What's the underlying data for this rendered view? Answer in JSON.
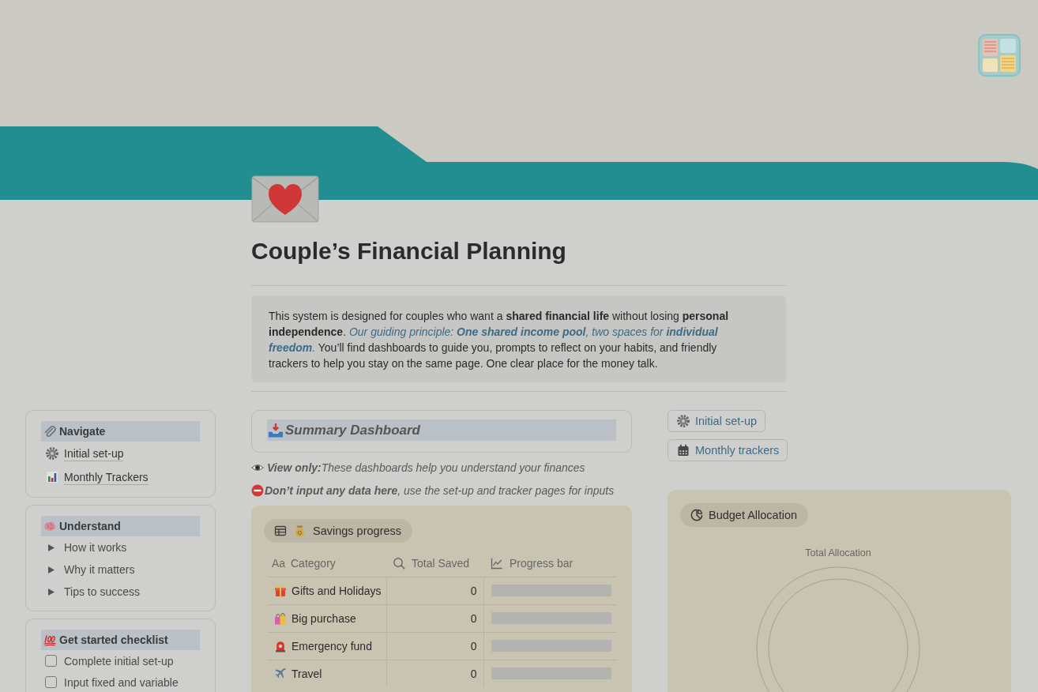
{
  "page": {
    "title": "Couple’s Financial Planning",
    "description": [
      {
        "kind": "plain",
        "text": "This system is designed for couples who want a **shared financial life** without losing **personal independence**. "
      },
      {
        "kind": "emphasis",
        "text": "Our guiding principle: **One shared income pool**, two spaces for **individual freedom**."
      },
      {
        "kind": "plain",
        "text": " You’ll find dashboards to guide you, prompts to reflect on your habits, and friendly trackers to help you stay on the same page. One clear place for the money talk."
      }
    ]
  },
  "sidebar": {
    "sections": [
      {
        "heading": "Navigate",
        "items": [
          {
            "kind": "link",
            "label": "Initial set-up"
          },
          {
            "kind": "link",
            "label": "Monthly Trackers"
          }
        ]
      },
      {
        "heading": "Understand",
        "items": [
          {
            "kind": "toggle",
            "label": "How it works",
            "expanded": false
          },
          {
            "kind": "toggle",
            "label": "Why it matters",
            "expanded": false
          },
          {
            "kind": "toggle",
            "label": "Tips to success",
            "expanded": false
          }
        ]
      },
      {
        "heading": "Get started checklist",
        "items": [
          {
            "kind": "checkbox",
            "label": "Complete initial set-up",
            "checked": false
          },
          {
            "kind": "checkbox",
            "label": "Input fixed and variable",
            "checked": false
          }
        ]
      }
    ]
  },
  "summary": {
    "heading": "Summary Dashboard",
    "notes": [
      {
        "kind": "info",
        "text": "**View only:**These dashboards help you understand your finances"
      },
      {
        "kind": "warning",
        "text": "**Don’t input any data here**, use the set-up and tracker pages for inputs"
      }
    ]
  },
  "savings": {
    "tab": "Savings progress",
    "columns": [
      {
        "label": "Category",
        "glyph": "Aa"
      },
      {
        "label": "Total Saved"
      },
      {
        "label": "Progress bar"
      }
    ],
    "rows": [
      {
        "category": "Gifts and Holidays",
        "total_saved": "0"
      },
      {
        "category": "Big purchase",
        "total_saved": "0"
      },
      {
        "category": "Emergency fund",
        "total_saved": "0"
      },
      {
        "category": "Travel",
        "total_saved": "0"
      }
    ]
  },
  "quick_links": [
    {
      "label": "Initial set-up"
    },
    {
      "label": "Monthly trackers"
    }
  ],
  "budget": {
    "tab": "Budget Allocation",
    "chart_data": {
      "type": "donut",
      "title": "Total Allocation"
    }
  }
}
